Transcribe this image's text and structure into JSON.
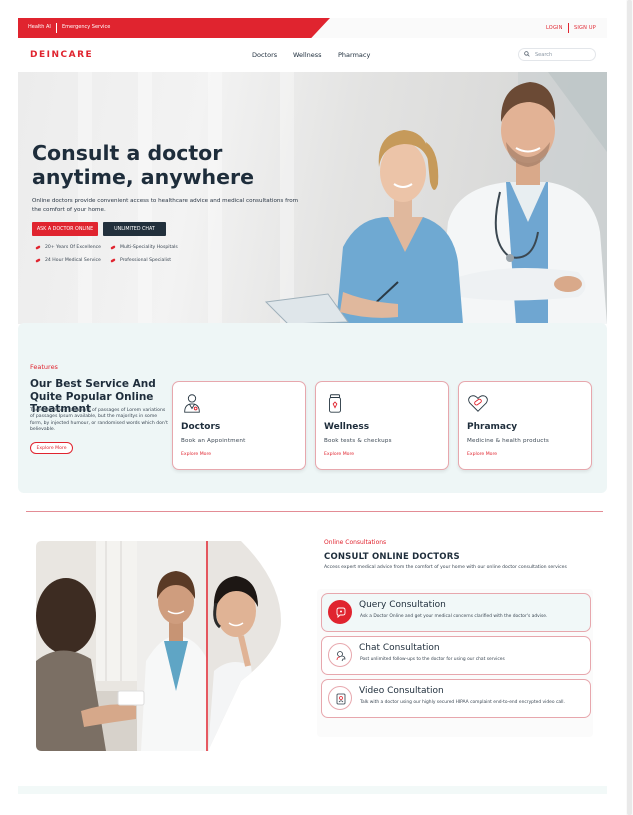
{
  "topbar": {
    "left_items": [
      "Health AI",
      "Emergency Service"
    ],
    "login": "LOGIN",
    "signup": "SIGN UP"
  },
  "nav": {
    "logo": "DEINCARE",
    "links": [
      "Doctors",
      "Wellness",
      "Pharmacy"
    ],
    "search_placeholder": "Search"
  },
  "hero": {
    "title": "Consult a doctor anytime, anywhere",
    "description": "Online doctors provide convenient access to healthcare advice and medical consultations from the comfort of your home.",
    "primary_button": "ASK A DOCTOR ONLINE",
    "secondary_button": "UNLIMITED CHAT",
    "features": [
      "20+ Years Of Excellence",
      "Multi-Speciality Hospitals",
      "24 Hour Medical Service",
      "Professional Specialist"
    ]
  },
  "features": {
    "tag": "Features",
    "title": "Our Best Service And Quite Popular Online Treatment",
    "body": "There are many variations of passages of Lorem variations of passages Ipsum available, but the majoritys in some form, by injected humour, or randomised words which don't believable.",
    "button": "Explore More",
    "cards": [
      {
        "title": "Doctors",
        "subtitle": "Book an Appointment",
        "link": "Explore More",
        "icon": "doctor-icon"
      },
      {
        "title": "Wellness",
        "subtitle": "Book tests & checkups",
        "link": "Explore More",
        "icon": "test-jar-icon"
      },
      {
        "title": "Phramacy",
        "subtitle": "Medicine & health products",
        "link": "Explore More",
        "icon": "heart-pill-icon"
      }
    ]
  },
  "consult": {
    "tag": "Online Consultations",
    "title": "CONSULT ONLINE DOCTORS",
    "description": "Access expert medical advice from the comfort of your home with our online doctor consultation services",
    "options": [
      {
        "title": "Query Consultation",
        "subtitle": "Ask a Doctor Online and get your medical concerns clarified with the doctor's advise.",
        "icon": "query-icon"
      },
      {
        "title": "Chat Consultation",
        "subtitle": "Post unlimited follow-ups to the doctor for using our chat services",
        "icon": "chat-icon"
      },
      {
        "title": "Video Consultation",
        "subtitle": "Talk with a doctor using our highly secured HIPAA complaint end-to-end encrypted video call.",
        "icon": "video-icon"
      }
    ]
  },
  "colors": {
    "brand_red": "#e0242f",
    "dark": "#22303c",
    "section_bg": "#eef6f6"
  }
}
